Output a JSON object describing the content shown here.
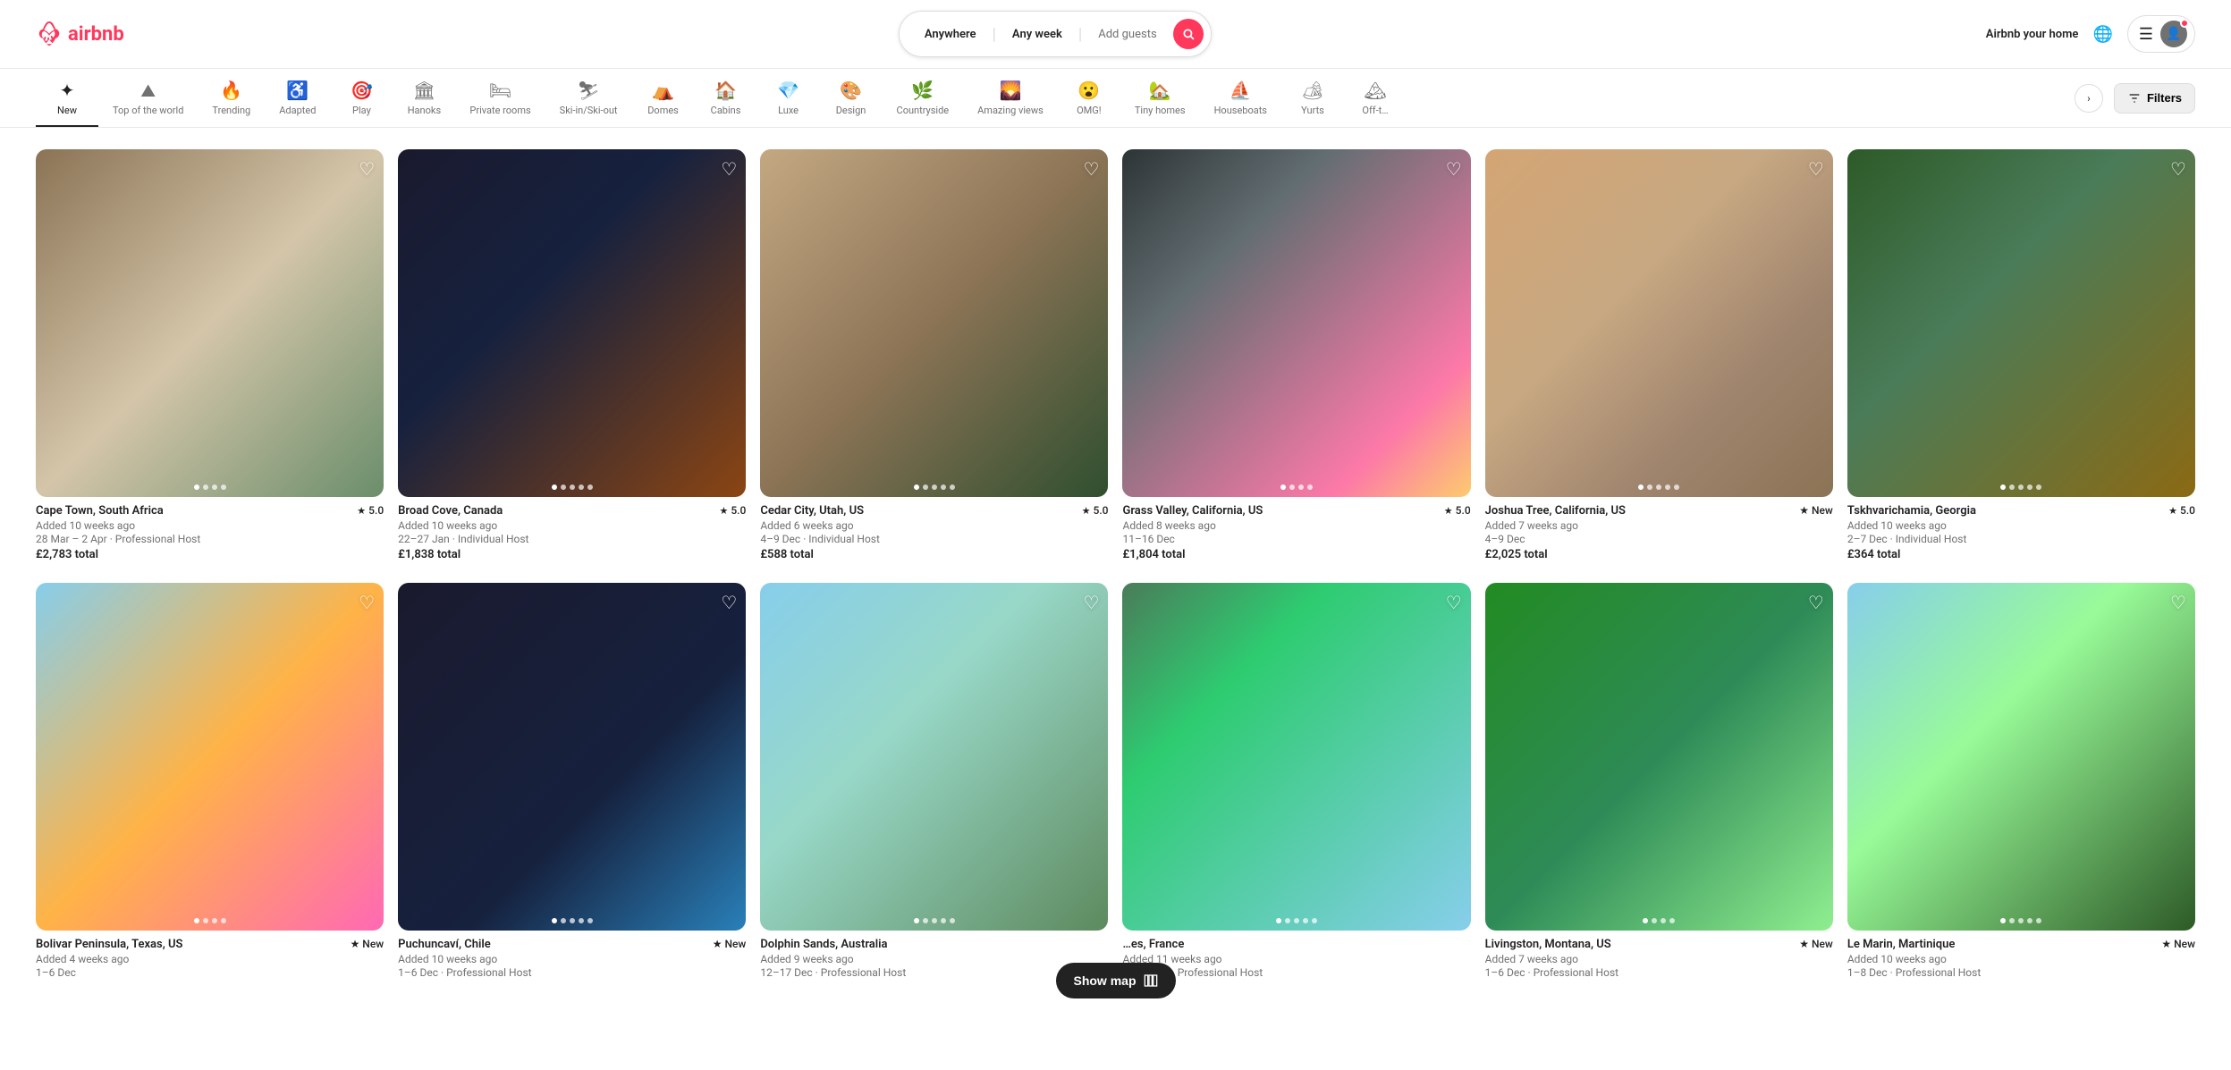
{
  "header": {
    "logo_text": "airbnb",
    "search": {
      "location": "Anywhere",
      "dates": "Any week",
      "guests_placeholder": "Add guests"
    },
    "airbnb_home": "Airbnb your home",
    "menu_icon": "☰"
  },
  "categories": [
    {
      "id": "new",
      "label": "New",
      "icon": "✦",
      "active": true
    },
    {
      "id": "top-of-world",
      "label": "Top of the world",
      "icon": "⛰",
      "active": false
    },
    {
      "id": "trending",
      "label": "Trending",
      "icon": "🔥",
      "active": false
    },
    {
      "id": "adapted",
      "label": "Adapted",
      "icon": "♿",
      "active": false
    },
    {
      "id": "play",
      "label": "Play",
      "icon": "🎯",
      "active": false
    },
    {
      "id": "hanoks",
      "label": "Hanoks",
      "icon": "🏛",
      "active": false
    },
    {
      "id": "private-rooms",
      "label": "Private rooms",
      "icon": "🛏",
      "active": false
    },
    {
      "id": "ski-in-out",
      "label": "Ski-in/Ski-out",
      "icon": "⛷",
      "active": false
    },
    {
      "id": "domes",
      "label": "Domes",
      "icon": "⛺",
      "active": false
    },
    {
      "id": "cabins",
      "label": "Cabins",
      "icon": "🏠",
      "active": false
    },
    {
      "id": "luxe",
      "label": "Luxe",
      "icon": "💎",
      "active": false
    },
    {
      "id": "design",
      "label": "Design",
      "icon": "🎨",
      "active": false
    },
    {
      "id": "countryside",
      "label": "Countryside",
      "icon": "🌿",
      "active": false
    },
    {
      "id": "amazing-views",
      "label": "Amazing views",
      "icon": "🌄",
      "active": false
    },
    {
      "id": "omg",
      "label": "OMG!",
      "icon": "😮",
      "active": false
    },
    {
      "id": "tiny-homes",
      "label": "Tiny homes",
      "icon": "🏡",
      "active": false
    },
    {
      "id": "houseboats",
      "label": "Houseboats",
      "icon": "⛵",
      "active": false
    },
    {
      "id": "yurts",
      "label": "Yurts",
      "icon": "🏕",
      "active": false
    },
    {
      "id": "off",
      "label": "Off-t…",
      "icon": "🏔",
      "active": false
    }
  ],
  "filters_label": "Filters",
  "listings_row1": [
    {
      "location": "Cape Town, South Africa",
      "rating": "5.0",
      "is_new": false,
      "subtitle": "Added 10 weeks ago",
      "dates": "28 Mar – 2 Apr · Professional Host",
      "price": "£2,783 total",
      "img_class": "c1",
      "dots": 4
    },
    {
      "location": "Broad Cove, Canada",
      "rating": "5.0",
      "is_new": false,
      "subtitle": "Added 10 weeks ago",
      "dates": "22–27 Jan · Individual Host",
      "price": "£1,838 total",
      "img_class": "c2",
      "dots": 5
    },
    {
      "location": "Cedar City, Utah, US",
      "rating": "5.0",
      "is_new": false,
      "subtitle": "Added 6 weeks ago",
      "dates": "4–9 Dec · Individual Host",
      "price": "£588 total",
      "img_class": "c3",
      "dots": 5
    },
    {
      "location": "Grass Valley, California, US",
      "rating": "5.0",
      "is_new": false,
      "subtitle": "Added 8 weeks ago",
      "dates": "11–16 Dec",
      "price": "£1,804 total",
      "img_class": "c4",
      "dots": 4
    },
    {
      "location": "Joshua Tree, California, US",
      "rating": "",
      "is_new": true,
      "subtitle": "Added 7 weeks ago",
      "dates": "4–9 Dec",
      "price": "£2,025 total",
      "img_class": "c5",
      "dots": 5
    },
    {
      "location": "Tskhvarichamia, Georgia",
      "rating": "5.0",
      "is_new": false,
      "subtitle": "Added 10 weeks ago",
      "dates": "2–7 Dec · Individual Host",
      "price": "£364 total",
      "img_class": "c6",
      "dots": 5
    }
  ],
  "listings_row2": [
    {
      "location": "Bolivar Peninsula, Texas, US",
      "rating": "",
      "is_new": true,
      "subtitle": "Added 4 weeks ago",
      "dates": "1–6 Dec",
      "price": "",
      "img_class": "c7",
      "dots": 4
    },
    {
      "location": "Puchuncaví, Chile",
      "rating": "",
      "is_new": true,
      "subtitle": "Added 10 weeks ago",
      "dates": "1–6 Dec · Professional Host",
      "price": "",
      "img_class": "c8",
      "dots": 5
    },
    {
      "location": "Dolphin Sands, Australia",
      "rating": "",
      "is_new": false,
      "subtitle": "Added 9 weeks ago",
      "dates": "12–17 Dec · Professional Host",
      "price": "",
      "img_class": "c9",
      "dots": 5
    },
    {
      "location": "…es, France",
      "rating": "",
      "is_new": false,
      "subtitle": "Added 11 weeks ago",
      "dates": "5–10 Mar · Professional Host",
      "price": "",
      "img_class": "c10",
      "dots": 5
    },
    {
      "location": "Livingston, Montana, US",
      "rating": "",
      "is_new": true,
      "subtitle": "Added 7 weeks ago",
      "dates": "1–6 Dec · Professional Host",
      "price": "",
      "img_class": "c11",
      "dots": 4
    },
    {
      "location": "Le Marin, Martinique",
      "rating": "",
      "is_new": true,
      "subtitle": "Added 10 weeks ago",
      "dates": "1–8 Dec · Professional Host",
      "price": "",
      "img_class": "c12",
      "dots": 5
    }
  ],
  "show_map_label": "Show map"
}
